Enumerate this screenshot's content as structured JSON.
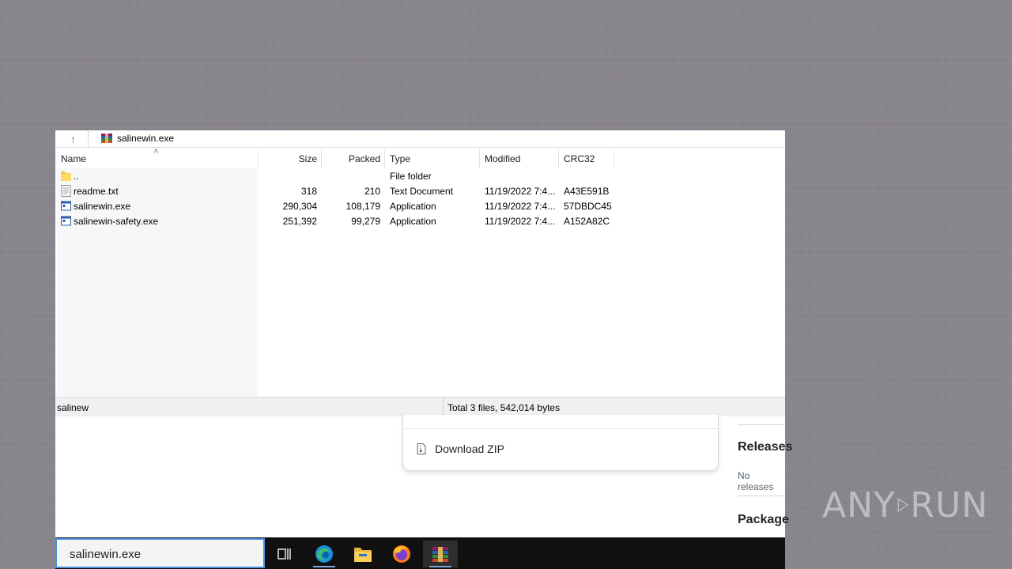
{
  "winrar": {
    "address": "salinewin.exe",
    "columns": [
      "Name",
      "Size",
      "Packed",
      "Type",
      "Modified",
      "CRC32"
    ],
    "rows": [
      {
        "name": "..",
        "size": "",
        "packed": "",
        "type": "File folder",
        "modified": "",
        "crc": "",
        "icon": "folder-icon"
      },
      {
        "name": "readme.txt",
        "size": "318",
        "packed": "210",
        "type": "Text Document",
        "modified": "11/19/2022 7:4...",
        "crc": "A43E591B",
        "icon": "text-file-icon"
      },
      {
        "name": "salinewin.exe",
        "size": "290,304",
        "packed": "108,179",
        "type": "Application",
        "modified": "11/19/2022 7:4...",
        "crc": "57DBDC45",
        "icon": "application-icon"
      },
      {
        "name": "salinewin-safety.exe",
        "size": "251,392",
        "packed": "99,279",
        "type": "Application",
        "modified": "11/19/2022 7:4...",
        "crc": "A152A82C",
        "icon": "application-icon"
      }
    ],
    "status_left": "salinew",
    "status_total": "Total 3 files, 542,014 bytes"
  },
  "browser": {
    "download_zip": "Download ZIP",
    "releases_heading": "Releases",
    "releases_sub": "No releases",
    "packages_heading": "Package"
  },
  "taskbar": {
    "search_value": "salinewin.exe",
    "icons": [
      "task-view-icon",
      "edge-icon",
      "file-explorer-icon",
      "firefox-icon",
      "winrar-icon"
    ]
  },
  "watermark": {
    "left": "ANY",
    "right": "RUN"
  },
  "colors": {
    "taskbar_bg": "#101010",
    "search_border": "#4a90d9",
    "status_bg": "#f0f0f0"
  }
}
